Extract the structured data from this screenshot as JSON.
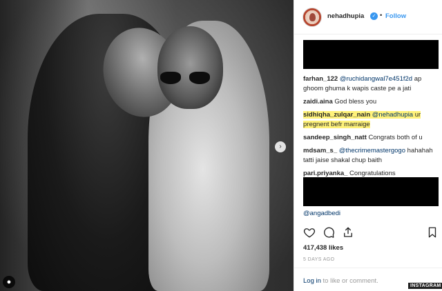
{
  "post": {
    "username": "nehadhupia",
    "follow_label": "Follow",
    "separator": "•",
    "likes": "417,438 likes",
    "date": "5 DAYS AGO",
    "login_link": "Log in",
    "login_rest": " to like or comment.",
    "watermark": "INSTAGRAM"
  },
  "comments": [
    {
      "user": "farhan_122",
      "mention": "@ruchidangwal7e451f2d",
      "text": " ap ghoom ghuma k wapis caste pe a jati",
      "highlight": false
    },
    {
      "user": "zaidi.aina",
      "mention": "",
      "text": " God bless you",
      "highlight": false
    },
    {
      "user": "sidhiqha_zulqar_nain",
      "mention": "@nehadhupia",
      "text": " ur pregnent befr marraige",
      "highlight": true
    },
    {
      "user": "sandeep_singh_natt",
      "mention": "",
      "text": " Congrats both of u",
      "highlight": false
    },
    {
      "user": "mdsam_s_",
      "mention": "@thecrimemastergogo",
      "text": " hahahah tatti jaise shakal chup baith",
      "highlight": false
    },
    {
      "user": "pari.priyanka_",
      "mention": "",
      "text": " Congratulations",
      "highlight": false
    },
    {
      "user": "",
      "mention": "@angadbedi",
      "text": "",
      "highlight": false
    }
  ],
  "icons": {
    "verified": "verified-badge-icon",
    "like": "heart-icon",
    "comment": "comment-icon",
    "share": "share-icon",
    "save": "bookmark-icon",
    "next": "chevron-right-icon",
    "user_tag": "person-icon"
  },
  "colors": {
    "link": "#003569",
    "follow": "#3897f0",
    "highlight": "#fff27a",
    "redaction": "#000000"
  }
}
